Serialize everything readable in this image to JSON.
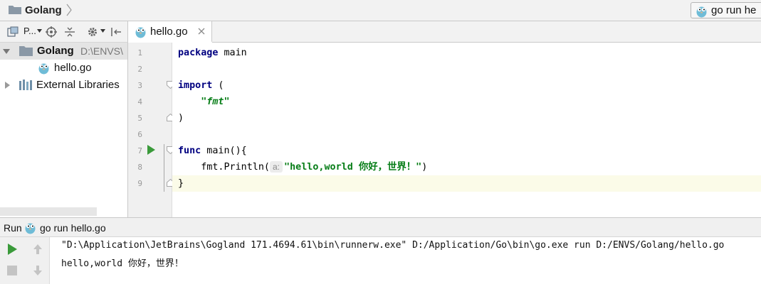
{
  "navbar": {
    "title": "Golang",
    "run_config": "go run he"
  },
  "project_toolbar": {
    "view_label": "P..."
  },
  "editor": {
    "tab_label": "hello.go",
    "line_numbers": [
      "1",
      "2",
      "3",
      "4",
      "5",
      "6",
      "7",
      "8",
      "9"
    ],
    "code": {
      "l1_kw": "package",
      "l1_rest": " main",
      "l3_kw": "import",
      "l3_rest": " (",
      "l4_indent": "    ",
      "l4_str": "\"fmt\"",
      "l5": ")",
      "l7_kw": "func",
      "l7_rest": " main(){",
      "l8_indent": "    ",
      "l8_call": "fmt.Println(",
      "l8_hint": "a:",
      "l8_str": "\"hello,world 你好，世界！\"",
      "l8_end": ")",
      "l9": "}"
    }
  },
  "project_tree": {
    "root_label": "Golang",
    "root_path": "D:\\ENVS\\",
    "file_label": "hello.go",
    "libraries_label": "External Libraries"
  },
  "run_panel": {
    "title": "Run",
    "tab_label": "go run hello.go",
    "console_lines": [
      "\"D:\\Application\\JetBrains\\Gogland 171.4694.61\\bin\\runnerw.exe\" D:/Application/Go\\bin\\go.exe run D:/ENVS/Golang/hello.go",
      "hello,world 你好，世界！"
    ]
  },
  "colors": {
    "keyword": "#000080",
    "string": "#067d17",
    "run_green": "#3a9a3a",
    "gopher_blue": "#6fbcd7"
  }
}
